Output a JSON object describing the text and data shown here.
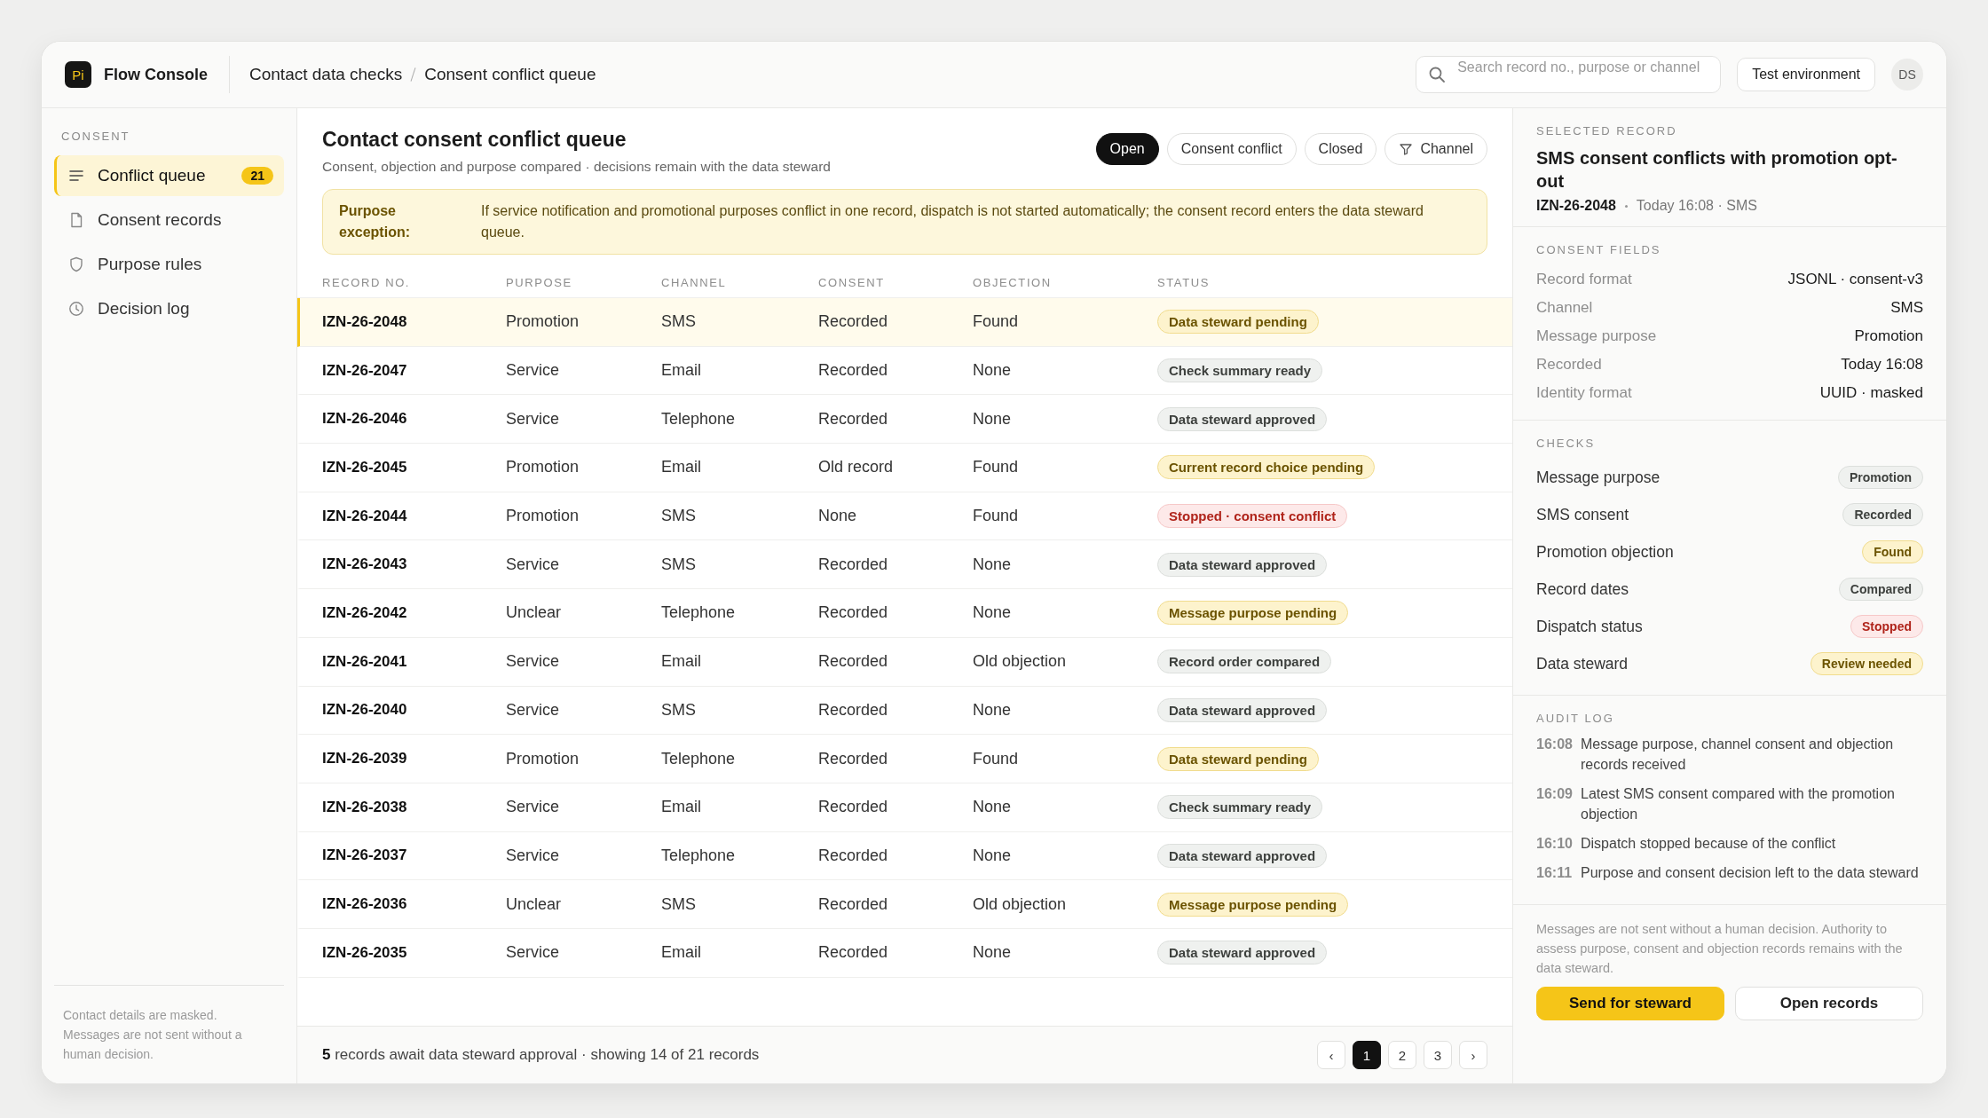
{
  "app": {
    "logo_text": "Pi",
    "name": "Flow Console"
  },
  "breadcrumb": [
    "Contact data checks",
    "Consent conflict queue"
  ],
  "search": {
    "placeholder": "Search record no., purpose or channel"
  },
  "environment": "Test environment",
  "avatar": "DS",
  "sidebar": {
    "section": "CONSENT",
    "items": [
      {
        "label": "Conflict queue",
        "selected": true,
        "badge": "21"
      },
      {
        "label": "Consent records",
        "selected": false
      },
      {
        "label": "Purpose rules",
        "selected": false
      },
      {
        "label": "Decision log",
        "selected": false
      }
    ],
    "note": "Contact details are masked. Messages are not sent without a human decision."
  },
  "queue": {
    "title": "Contact consent conflict queue",
    "subtitle": "Consent, objection and purpose compared · decisions remain with the data steward",
    "filters": [
      {
        "label": "Open",
        "selected": true,
        "kind": "toggle"
      },
      {
        "label": "Consent conflict",
        "selected": false,
        "kind": "toggle"
      },
      {
        "label": "Closed",
        "selected": false,
        "kind": "toggle"
      },
      {
        "label": "Channel",
        "selected": false,
        "kind": "filter"
      }
    ],
    "notice": {
      "label": "Purpose exception:",
      "text": "If service notification and promotional purposes conflict in one record, dispatch is not started automatically; the consent record enters the data steward queue."
    }
  },
  "table": {
    "columns": [
      "RECORD NO.",
      "PURPOSE",
      "CHANNEL",
      "CONSENT",
      "OBJECTION",
      "STATUS"
    ],
    "rows": [
      {
        "record": "IZN-26-2048",
        "purpose": "Promotion",
        "channel": "SMS",
        "consent": "Recorded",
        "objection": "Found",
        "status": "Data steward pending",
        "kind": "pending",
        "selected": true
      },
      {
        "record": "IZN-26-2047",
        "purpose": "Service",
        "channel": "Email",
        "consent": "Recorded",
        "objection": "None",
        "status": "Check summary ready",
        "kind": "neutral",
        "selected": false
      },
      {
        "record": "IZN-26-2046",
        "purpose": "Service",
        "channel": "Telephone",
        "consent": "Recorded",
        "objection": "None",
        "status": "Data steward approved",
        "kind": "neutral",
        "selected": false
      },
      {
        "record": "IZN-26-2045",
        "purpose": "Promotion",
        "channel": "Email",
        "consent": "Old record",
        "objection": "Found",
        "status": "Current record choice pending",
        "kind": "pending",
        "selected": false
      },
      {
        "record": "IZN-26-2044",
        "purpose": "Promotion",
        "channel": "SMS",
        "consent": "None",
        "objection": "Found",
        "status": "Stopped · consent conflict",
        "kind": "stopped",
        "selected": false
      },
      {
        "record": "IZN-26-2043",
        "purpose": "Service",
        "channel": "SMS",
        "consent": "Recorded",
        "objection": "None",
        "status": "Data steward approved",
        "kind": "neutral",
        "selected": false
      },
      {
        "record": "IZN-26-2042",
        "purpose": "Unclear",
        "channel": "Telephone",
        "consent": "Recorded",
        "objection": "None",
        "status": "Message purpose pending",
        "kind": "pending",
        "selected": false
      },
      {
        "record": "IZN-26-2041",
        "purpose": "Service",
        "channel": "Email",
        "consent": "Recorded",
        "objection": "Old objection",
        "status": "Record order compared",
        "kind": "neutral",
        "selected": false
      },
      {
        "record": "IZN-26-2040",
        "purpose": "Service",
        "channel": "SMS",
        "consent": "Recorded",
        "objection": "None",
        "status": "Data steward approved",
        "kind": "neutral",
        "selected": false
      },
      {
        "record": "IZN-26-2039",
        "purpose": "Promotion",
        "channel": "Telephone",
        "consent": "Recorded",
        "objection": "Found",
        "status": "Data steward pending",
        "kind": "pending",
        "selected": false
      },
      {
        "record": "IZN-26-2038",
        "purpose": "Service",
        "channel": "Email",
        "consent": "Recorded",
        "objection": "None",
        "status": "Check summary ready",
        "kind": "neutral",
        "selected": false
      },
      {
        "record": "IZN-26-2037",
        "purpose": "Service",
        "channel": "Telephone",
        "consent": "Recorded",
        "objection": "None",
        "status": "Data steward approved",
        "kind": "neutral",
        "selected": false
      },
      {
        "record": "IZN-26-2036",
        "purpose": "Unclear",
        "channel": "SMS",
        "consent": "Recorded",
        "objection": "Old objection",
        "status": "Message purpose pending",
        "kind": "pending",
        "selected": false
      },
      {
        "record": "IZN-26-2035",
        "purpose": "Service",
        "channel": "Email",
        "consent": "Recorded",
        "objection": "None",
        "status": "Data steward approved",
        "kind": "neutral",
        "selected": false
      }
    ],
    "summary": "**5** records await data steward approval · showing 14 of 21 records",
    "pagination": {
      "prev": "‹",
      "next": "›",
      "pages": [
        {
          "label": "1",
          "selected": true
        },
        {
          "label": "2",
          "selected": false
        },
        {
          "label": "3",
          "selected": false
        }
      ]
    }
  },
  "detail": {
    "section": "SELECTED RECORD",
    "title": "SMS consent conflicts with promotion opt-out",
    "record": "IZN-26-2048",
    "meta": "Today 16:08 · SMS",
    "fields_title": "CONSENT FIELDS",
    "fields": [
      {
        "label": "Record format",
        "value": "JSONL · consent-v3"
      },
      {
        "label": "Channel",
        "value": "SMS"
      },
      {
        "label": "Message purpose",
        "value": "Promotion"
      },
      {
        "label": "Recorded",
        "value": "Today 16:08"
      },
      {
        "label": "Identity format",
        "value": "UUID · masked"
      }
    ],
    "checks_title": "CHECKS",
    "checks": [
      {
        "label": "Message purpose",
        "value": "Promotion",
        "kind": "neutral"
      },
      {
        "label": "SMS consent",
        "value": "Recorded",
        "kind": "neutral"
      },
      {
        "label": "Promotion objection",
        "value": "Found",
        "kind": "pending"
      },
      {
        "label": "Record dates",
        "value": "Compared",
        "kind": "neutral"
      },
      {
        "label": "Dispatch status",
        "value": "Stopped",
        "kind": "stopped"
      },
      {
        "label": "Data steward",
        "value": "Review needed",
        "kind": "pending"
      }
    ],
    "audit_title": "AUDIT LOG",
    "audit": [
      {
        "time": "16:08",
        "text": "Message purpose, channel consent and objection records received"
      },
      {
        "time": "16:09",
        "text": "Latest SMS consent compared with the promotion objection"
      },
      {
        "time": "16:10",
        "text": "Dispatch stopped because of the conflict"
      },
      {
        "time": "16:11",
        "text": "Purpose and consent decision left to the data steward"
      }
    ],
    "note": "Messages are not sent without a human decision. Authority to assess purpose, consent and objection records remains with the data steward.",
    "actions": [
      {
        "label": "Send for steward",
        "kind": "primary"
      },
      {
        "label": "Open records",
        "kind": "secondary"
      }
    ]
  }
}
